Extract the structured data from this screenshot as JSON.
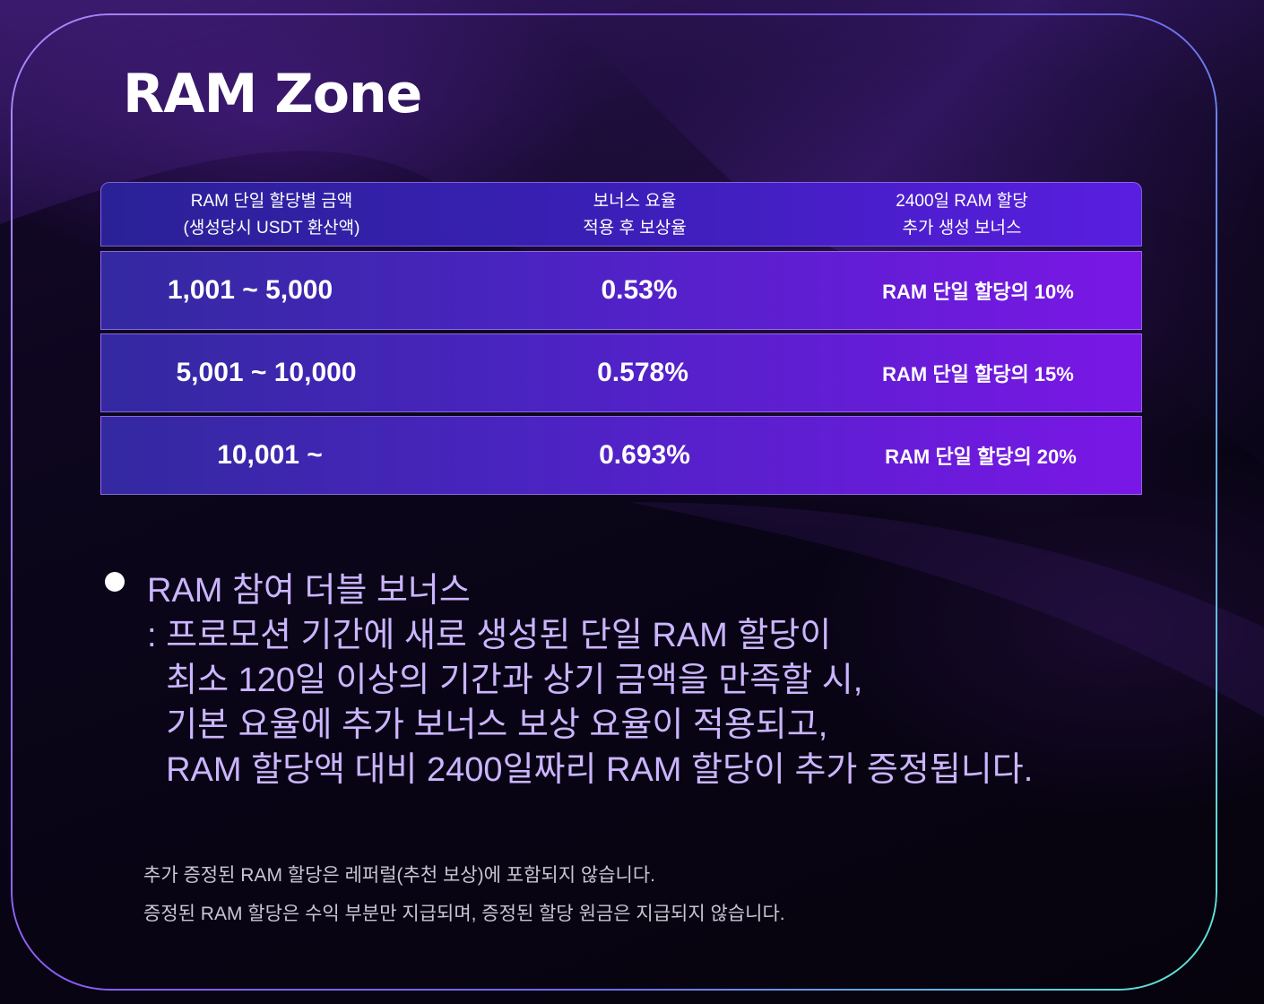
{
  "title": "RAM Zone",
  "table": {
    "headers": [
      [
        "RAM 단일 할당별 금액",
        "(생성당시 USDT 환산액)"
      ],
      [
        "보너스 요율",
        "적용 후 보상율"
      ],
      [
        "2400일 RAM 할당",
        "추가 생성 보너스"
      ]
    ],
    "rows": [
      {
        "range": "1,001 ~ 5,000",
        "rate": "0.53%",
        "bonus": "RAM 단일 할당의 10%"
      },
      {
        "range": "5,001 ~ 10,000",
        "rate": "0.578%",
        "bonus": "RAM 단일 할당의 15%"
      },
      {
        "range": "10,001 ~",
        "rate": "0.693%",
        "bonus": "RAM 단일 할당의 20%"
      }
    ]
  },
  "promo": {
    "lines": [
      "RAM 참여 더블 보너스",
      ": 프로모션 기간에 새로 생성된 단일 RAM 할당이",
      "  최소 120일 이상의 기간과 상기 금액을 만족할 시,",
      "  기본 요율에 추가 보너스 보상 요율이 적용되고,",
      "  RAM 할당액 대비 2400일짜리 RAM 할당이 추가 증정됩니다."
    ]
  },
  "notes": [
    "추가 증정된 RAM 할당은 레퍼럴(추천 보상)에 포함되지 않습니다.",
    "증정된 RAM 할당은 수익 부분만 지급되며, 증정된 할당 원금은 지급되지 않습니다."
  ],
  "colors": {
    "background": "#07040f",
    "frame_start": "#a78bfa",
    "frame_end": "#5eead4",
    "row_start": "#3329a0",
    "row_end": "#7a17e6",
    "promo_text": "#cbb5ff",
    "note_text": "#c9c6d4"
  }
}
